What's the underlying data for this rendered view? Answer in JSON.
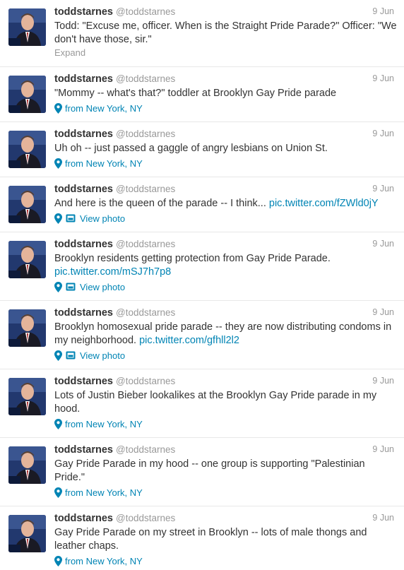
{
  "colors": {
    "link": "#0084b4",
    "muted": "#999999",
    "text": "#333333"
  },
  "icons": {
    "location": "map-pin-icon",
    "photo": "photo-icon"
  },
  "tweets": [
    {
      "name": "toddstarnes",
      "handle": "@toddstarnes",
      "date": "9 Jun",
      "text": "Todd: \"Excuse me, officer. When is the Straight Pride Parade?\" Officer: \"We don't have those, sir.\"",
      "link": "",
      "expand": "Expand",
      "location": "",
      "photo": ""
    },
    {
      "name": "toddstarnes",
      "handle": "@toddstarnes",
      "date": "9 Jun",
      "text": "\"Mommy -- what's that?\" toddler at Brooklyn Gay Pride parade",
      "link": "",
      "expand": "",
      "location": "from New York, NY",
      "photo": ""
    },
    {
      "name": "toddstarnes",
      "handle": "@toddstarnes",
      "date": "9 Jun",
      "text": "Uh oh -- just passed a gaggle of angry lesbians on Union St.",
      "link": "",
      "expand": "",
      "location": "from New York, NY",
      "photo": ""
    },
    {
      "name": "toddstarnes",
      "handle": "@toddstarnes",
      "date": "9 Jun",
      "text": "And here is the queen of the parade -- I think...",
      "link": "pic.twitter.com/fZWld0jY",
      "expand": "",
      "location": "",
      "photo": "View photo"
    },
    {
      "name": "toddstarnes",
      "handle": "@toddstarnes",
      "date": "9 Jun",
      "text": "Brooklyn residents getting protection from Gay Pride Parade.",
      "link": "pic.twitter.com/mSJ7h7p8",
      "expand": "",
      "location": "",
      "photo": "View photo"
    },
    {
      "name": "toddstarnes",
      "handle": "@toddstarnes",
      "date": "9 Jun",
      "text": "Brooklyn homosexual pride parade -- they are now distributing condoms in my neighborhood.",
      "link": "pic.twitter.com/gfhll2l2",
      "expand": "",
      "location": "",
      "photo": "View photo"
    },
    {
      "name": "toddstarnes",
      "handle": "@toddstarnes",
      "date": "9 Jun",
      "text": "Lots of Justin Bieber lookalikes at the Brooklyn Gay Pride parade in my hood.",
      "link": "",
      "expand": "",
      "location": "from New York, NY",
      "photo": ""
    },
    {
      "name": "toddstarnes",
      "handle": "@toddstarnes",
      "date": "9 Jun",
      "text": "Gay Pride Parade in my hood -- one group is supporting \"Palestinian Pride.\"",
      "link": "",
      "expand": "",
      "location": "from New York, NY",
      "photo": ""
    },
    {
      "name": "toddstarnes",
      "handle": "@toddstarnes",
      "date": "9 Jun",
      "text": "Gay Pride Parade on my street in Brooklyn -- lots of male thongs and leather chaps.",
      "link": "",
      "expand": "",
      "location": "from New York, NY",
      "photo": ""
    }
  ]
}
